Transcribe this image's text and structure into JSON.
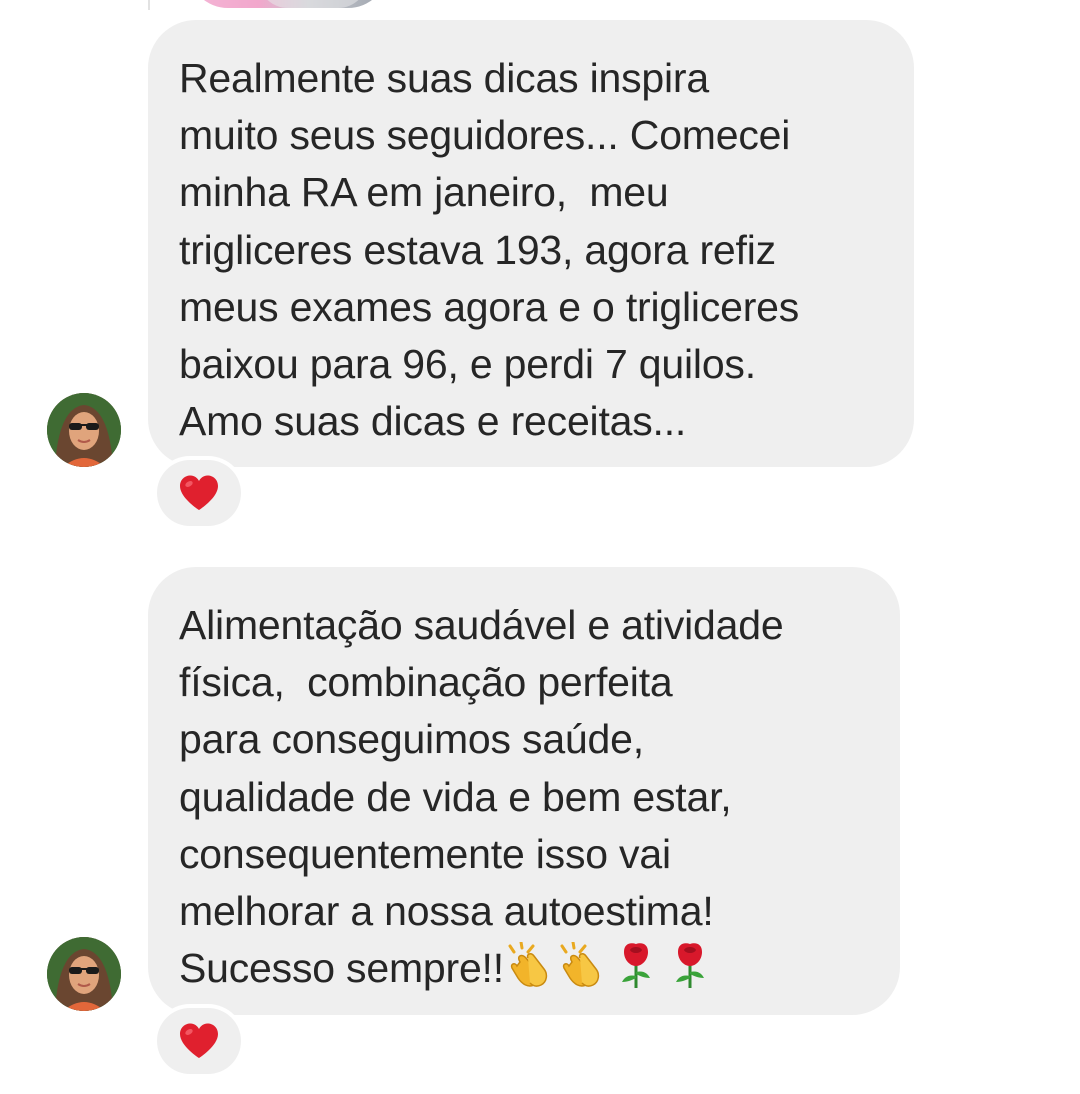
{
  "colors": {
    "bubble": "#efefef",
    "text": "#262626",
    "heart": "#e0202e",
    "background": "#ffffff"
  },
  "messages": [
    {
      "lines": [
        "Realmente suas dicas inspira",
        "muito seus seguidores... Comecei",
        "minha RA em janeiro,  meu",
        "trigliceres estava 193, agora refiz",
        "meus exames agora e o trigliceres",
        "baixou para 96, e perdi 7 quilos.",
        "Amo suas dicas e receitas..."
      ],
      "trailing_emojis": [],
      "reaction": "heart-icon"
    },
    {
      "lines": [
        "Alimentação saudável e atividade",
        "física,  combinação perfeita",
        "para conseguimos saúde,",
        "qualidade de vida e bem estar,",
        "consequentemente isso vai",
        "melhorar a nossa autoestima!",
        "Sucesso sempre!!"
      ],
      "trailing_emojis": [
        "clapping-hands-icon",
        "clapping-hands-icon",
        "rose-icon",
        "rose-icon"
      ],
      "reaction": "heart-icon"
    }
  ]
}
